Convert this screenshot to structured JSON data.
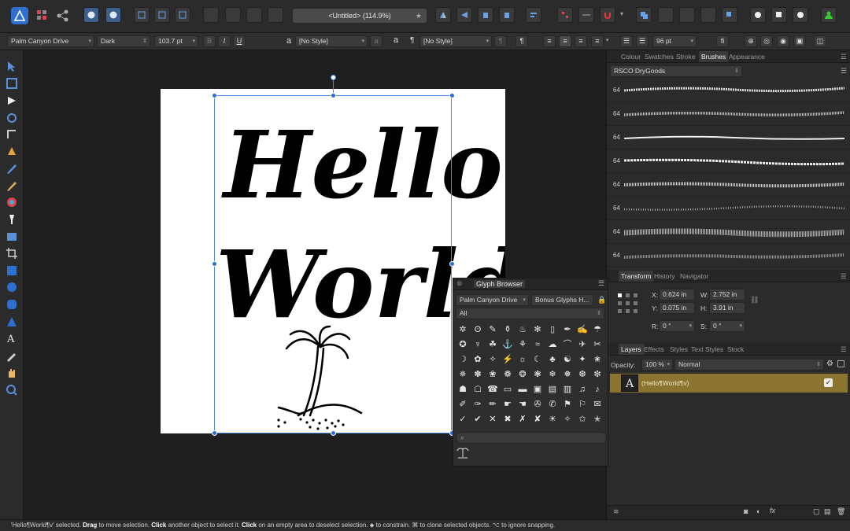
{
  "document": {
    "title": "<Untitled> (114.9%)",
    "star": "★"
  },
  "context_bar": {
    "font_family": "Palm Canyon Drive",
    "font_style": "Dark",
    "font_size": "103.7 pt",
    "bold": "B",
    "italic": "I",
    "underline": "U",
    "char_style_icon": "a",
    "char_style": "[No Style]",
    "para_icon_a": "a",
    "para_style_icon": "¶",
    "para_style": "[No Style]",
    "leading": "96 pt",
    "fi": "fi",
    "colors": {
      "text": "#000000"
    }
  },
  "panels": {
    "top_tabs": [
      "Colour",
      "Swatches",
      "Stroke",
      "Brushes",
      "Appearance"
    ],
    "active_top_tab": "Brushes",
    "brush_category": "RSCO DryGoods",
    "brush_sizes": [
      "64",
      "64",
      "64",
      "64",
      "64",
      "64",
      "64",
      "64"
    ],
    "transform_tabs": [
      "Transform",
      "History",
      "Navigator"
    ],
    "transform": {
      "x_label": "X:",
      "x": "0.624 in",
      "y_label": "Y:",
      "y": "0.075 in",
      "w_label": "W:",
      "w": "2.752 in",
      "h_label": "H:",
      "h": "3.91 in",
      "r_label": "R:",
      "r": "0 °",
      "s_label": "S:",
      "s": "0 °"
    },
    "layers_tabs": [
      "Layers",
      "Effects",
      "Styles",
      "Text Styles",
      "Stock"
    ],
    "opacity_label": "Opacity:",
    "opacity": "100 %",
    "blend_mode": "Normal",
    "layer": {
      "name": "(Hello¶World¶v)",
      "thumb": "A",
      "checked": "✓",
      "highlight": "#8a7430"
    }
  },
  "glyph_browser": {
    "title": "Glyph Browser",
    "font": "Palm Canyon Drive",
    "set": "Bonus Glyphs H...",
    "range": "All",
    "search_placeholder": ""
  },
  "artwork": {
    "line1": "Hello",
    "line2": "World"
  },
  "status": {
    "prefix": "'Hello¶World¶v' selected. ",
    "drag": "Drag",
    "t1": " to move selection. ",
    "click1": "Click",
    "t2": " another object to select it. ",
    "click2": "Click",
    "t3": " on an empty area to deselect selection. ⬥ to constrain. ⌘ to clone selected objects. ⌥ to ignore snapping."
  }
}
